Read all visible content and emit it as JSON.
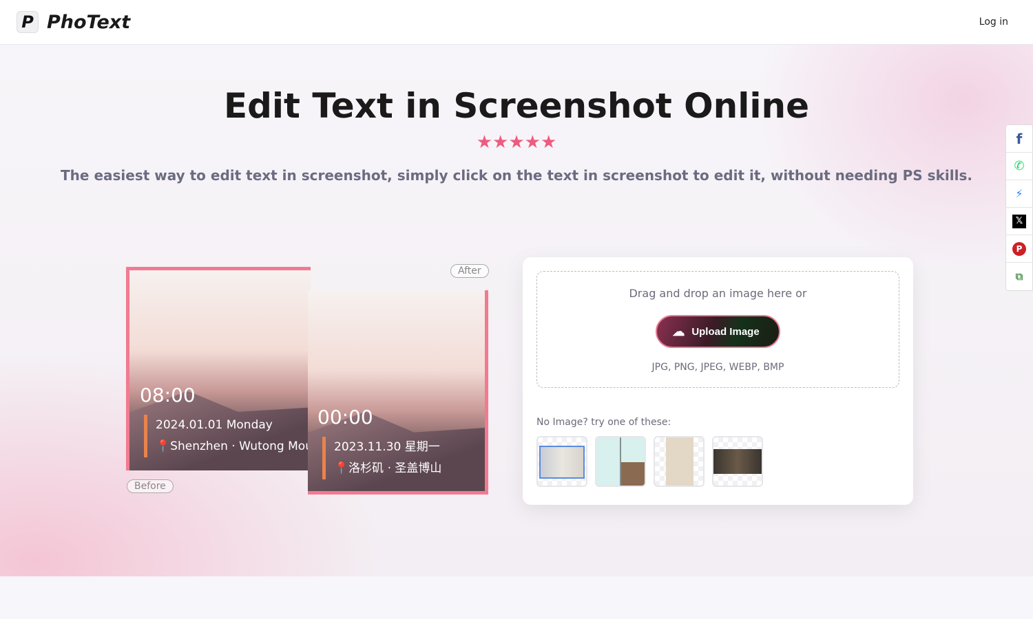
{
  "header": {
    "brand": "PhoText",
    "logo_letter": "P",
    "login": "Log in"
  },
  "hero": {
    "title": "Edit Text in Screenshot Online",
    "rating_stars": "★★★★★",
    "rating": 5,
    "subtitle": "The easiest way to edit text in screenshot, simply click on the text in screenshot to edit it, without needing PS skills."
  },
  "demo": {
    "before": {
      "label": "Before",
      "time": "08:00",
      "date": "2024.01.01 Monday",
      "location": "📍Shenzhen · Wutong Mountain"
    },
    "after": {
      "label": "After",
      "time": "00:00",
      "date": "2023.11.30 星期一",
      "location": "📍洛杉矶 · 圣盖博山"
    }
  },
  "upload": {
    "drop_text": "Drag and drop an image here or",
    "button": "Upload Image",
    "formats": "JPG, PNG, JPEG, WEBP, BMP",
    "try_text": "No Image? try one of these:"
  },
  "samples": [
    "document",
    "comic",
    "invitation",
    "poster"
  ],
  "share": [
    {
      "icon": "facebook-icon",
      "glyph": "f",
      "color": "#3b5998"
    },
    {
      "icon": "whatsapp-icon",
      "glyph": "✆",
      "color": "#25d366"
    },
    {
      "icon": "messenger-icon",
      "glyph": "⚡",
      "color": "#1e88f5"
    },
    {
      "icon": "x-icon",
      "glyph": "𝕏",
      "color": "#000000"
    },
    {
      "icon": "pinterest-icon",
      "glyph": "P",
      "color": "#cb2027"
    },
    {
      "icon": "copy-icon",
      "glyph": "⧉",
      "color": "#5a9a5a"
    }
  ]
}
